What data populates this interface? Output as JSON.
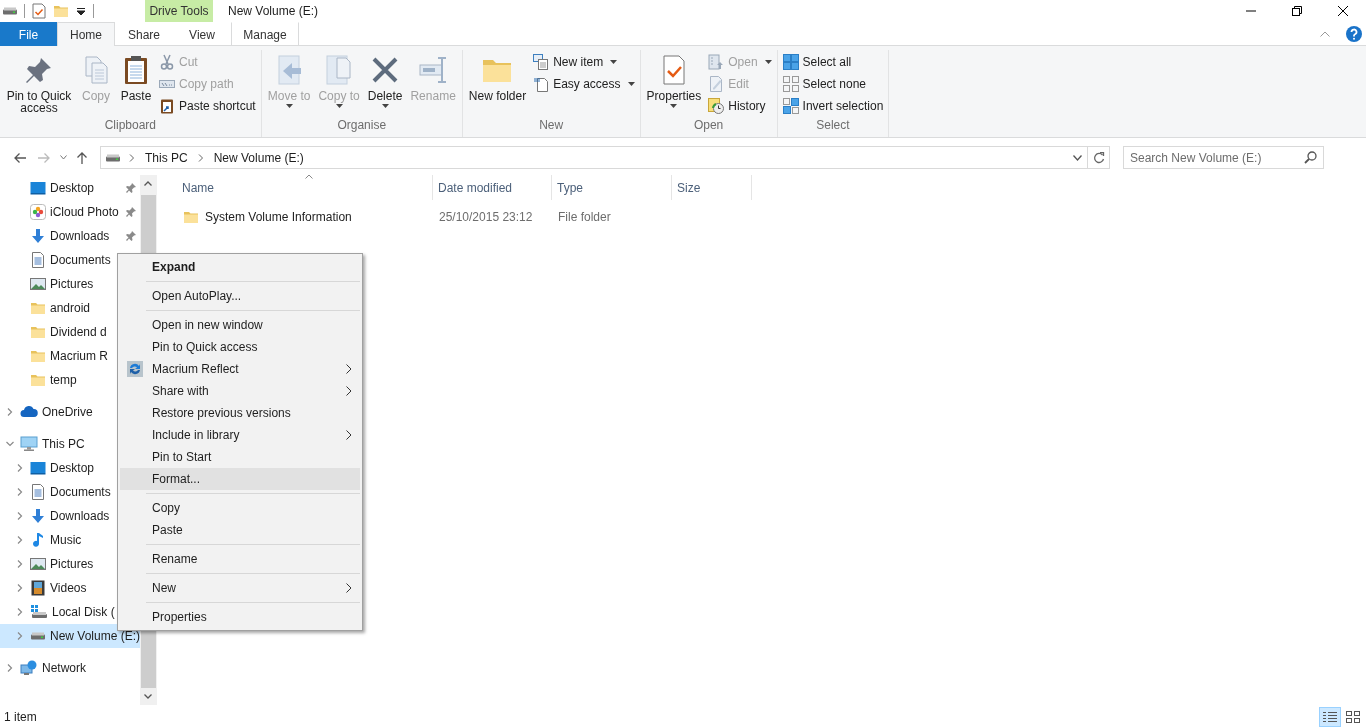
{
  "window": {
    "title": "New Volume (E:)",
    "context_tab_group": "Drive Tools"
  },
  "ribbon_tabs": [
    {
      "label": "File",
      "kind": "file",
      "selected": false
    },
    {
      "label": "Home",
      "kind": "tab",
      "selected": true
    },
    {
      "label": "Share",
      "kind": "tab",
      "selected": false
    },
    {
      "label": "View",
      "kind": "tab",
      "selected": false
    },
    {
      "label": "Manage",
      "kind": "contextual",
      "selected": false
    }
  ],
  "ribbon_groups": [
    {
      "label": "Clipboard",
      "columns": [
        {
          "kind": "large",
          "commands": [
            {
              "label": "Pin to Quick access",
              "disabled": false,
              "dropdown": false
            }
          ]
        },
        {
          "kind": "large",
          "commands": [
            {
              "label": "Copy",
              "disabled": true,
              "dropdown": false
            }
          ]
        },
        {
          "kind": "large",
          "commands": [
            {
              "label": "Paste",
              "disabled": false,
              "dropdown": false
            }
          ]
        },
        {
          "kind": "stack",
          "commands": [
            {
              "label": "Cut",
              "disabled": true,
              "dropdown": false
            },
            {
              "label": "Copy path",
              "disabled": true,
              "dropdown": false
            },
            {
              "label": "Paste shortcut",
              "disabled": false,
              "dropdown": false
            }
          ]
        }
      ]
    },
    {
      "label": "Organise",
      "columns": [
        {
          "kind": "large",
          "commands": [
            {
              "label": "Move to",
              "disabled": true,
              "dropdown": true
            }
          ]
        },
        {
          "kind": "large",
          "commands": [
            {
              "label": "Copy to",
              "disabled": true,
              "dropdown": true
            }
          ]
        },
        {
          "kind": "large",
          "commands": [
            {
              "label": "Delete",
              "disabled": false,
              "dropdown": true
            }
          ]
        },
        {
          "kind": "large",
          "commands": [
            {
              "label": "Rename",
              "disabled": true,
              "dropdown": false
            }
          ]
        }
      ]
    },
    {
      "label": "New",
      "columns": [
        {
          "kind": "large",
          "commands": [
            {
              "label": "New folder",
              "disabled": false,
              "dropdown": false
            }
          ]
        },
        {
          "kind": "stack",
          "commands": [
            {
              "label": "New item",
              "disabled": false,
              "dropdown": true
            },
            {
              "label": "Easy access",
              "disabled": false,
              "dropdown": true
            }
          ]
        }
      ]
    },
    {
      "label": "Open",
      "columns": [
        {
          "kind": "large",
          "commands": [
            {
              "label": "Properties",
              "disabled": false,
              "dropdown": true
            }
          ]
        },
        {
          "kind": "stack",
          "commands": [
            {
              "label": "Open",
              "disabled": true,
              "dropdown": true
            },
            {
              "label": "Edit",
              "disabled": true,
              "dropdown": false
            },
            {
              "label": "History",
              "disabled": false,
              "dropdown": false
            }
          ]
        }
      ]
    },
    {
      "label": "Select",
      "columns": [
        {
          "kind": "stack",
          "commands": [
            {
              "label": "Select all",
              "disabled": false,
              "dropdown": false
            },
            {
              "label": "Select none",
              "disabled": false,
              "dropdown": false
            },
            {
              "label": "Invert selection",
              "disabled": false,
              "dropdown": false
            }
          ]
        }
      ]
    }
  ],
  "address_bar": {
    "breadcrumbs": [
      "This PC",
      "New Volume (E:)"
    ]
  },
  "search": {
    "placeholder": "Search New Volume (E:)"
  },
  "navigation": {
    "quick_access": [
      {
        "label": "Desktop",
        "kind": "desktop",
        "pinned": true
      },
      {
        "label": "iCloud Photo",
        "kind": "photos",
        "pinned": true
      },
      {
        "label": "Downloads",
        "kind": "downloads",
        "pinned": true
      },
      {
        "label": "Documents",
        "kind": "documents",
        "pinned": false
      },
      {
        "label": "Pictures",
        "kind": "pictures",
        "pinned": false
      },
      {
        "label": "android",
        "kind": "folder",
        "pinned": false
      },
      {
        "label": "Dividend d",
        "kind": "folder",
        "pinned": false
      },
      {
        "label": "Macrium R",
        "kind": "folder",
        "pinned": false
      },
      {
        "label": "temp",
        "kind": "folder",
        "pinned": false
      }
    ],
    "tree": [
      {
        "label": "OneDrive",
        "kind": "cloud",
        "expanded": false,
        "selected": false
      },
      {
        "label": "This PC",
        "kind": "pc",
        "expanded": true,
        "selected": false,
        "children": [
          {
            "label": "Desktop",
            "kind": "desktop",
            "expanded": false,
            "selected": false
          },
          {
            "label": "Documents",
            "kind": "documents",
            "expanded": false,
            "selected": false
          },
          {
            "label": "Downloads",
            "kind": "downloads",
            "expanded": false,
            "selected": false
          },
          {
            "label": "Music",
            "kind": "music",
            "expanded": false,
            "selected": false
          },
          {
            "label": "Pictures",
            "kind": "pictures",
            "expanded": false,
            "selected": false
          },
          {
            "label": "Videos",
            "kind": "videos",
            "expanded": false,
            "selected": false
          },
          {
            "label": "Local Disk (",
            "kind": "disk",
            "expanded": false,
            "selected": false
          },
          {
            "label": "New Volume (E:)",
            "kind": "drive",
            "expanded": false,
            "selected": true
          }
        ]
      },
      {
        "label": "Network",
        "kind": "network",
        "expanded": false,
        "selected": false
      }
    ]
  },
  "file_list": {
    "columns": [
      {
        "label": "Name",
        "sorted": true
      },
      {
        "label": "Date modified",
        "sorted": false
      },
      {
        "label": "Type",
        "sorted": false
      },
      {
        "label": "Size",
        "sorted": false
      }
    ],
    "rows": [
      {
        "name": "System Volume Information",
        "date_modified": "25/10/2015 23:12",
        "type": "File folder",
        "size": ""
      }
    ]
  },
  "context_menu": [
    {
      "kind": "item",
      "label": "Expand",
      "default": true,
      "submenu": false,
      "selected": false
    },
    {
      "kind": "separator"
    },
    {
      "kind": "item",
      "label": "Open AutoPlay...",
      "default": false,
      "submenu": false,
      "selected": false
    },
    {
      "kind": "separator"
    },
    {
      "kind": "item",
      "label": "Open in new window",
      "default": false,
      "submenu": false,
      "selected": false
    },
    {
      "kind": "item",
      "label": "Pin to Quick access",
      "default": false,
      "submenu": false,
      "selected": false
    },
    {
      "kind": "app-item",
      "label": "Macrium Reflect",
      "default": false,
      "submenu": true,
      "selected": false
    },
    {
      "kind": "item",
      "label": "Share with",
      "default": false,
      "submenu": true,
      "selected": false
    },
    {
      "kind": "item",
      "label": "Restore previous versions",
      "default": false,
      "submenu": false,
      "selected": false
    },
    {
      "kind": "item",
      "label": "Include in library",
      "default": false,
      "submenu": true,
      "selected": false
    },
    {
      "kind": "item",
      "label": "Pin to Start",
      "default": false,
      "submenu": false,
      "selected": false
    },
    {
      "kind": "item",
      "label": "Format...",
      "default": false,
      "submenu": false,
      "selected": true
    },
    {
      "kind": "separator"
    },
    {
      "kind": "item",
      "label": "Copy",
      "default": false,
      "submenu": false,
      "selected": false
    },
    {
      "kind": "item",
      "label": "Paste",
      "default": false,
      "submenu": false,
      "selected": false
    },
    {
      "kind": "separator"
    },
    {
      "kind": "item",
      "label": "Rename",
      "default": false,
      "submenu": false,
      "selected": false
    },
    {
      "kind": "separator"
    },
    {
      "kind": "item",
      "label": "New",
      "default": false,
      "submenu": true,
      "selected": false
    },
    {
      "kind": "separator"
    },
    {
      "kind": "item",
      "label": "Properties",
      "default": false,
      "submenu": false,
      "selected": false
    }
  ],
  "status_bar": {
    "item_count": "1 item"
  },
  "view_modes": [
    {
      "kind": "details",
      "selected": true
    },
    {
      "kind": "large-icons",
      "selected": false
    }
  ]
}
